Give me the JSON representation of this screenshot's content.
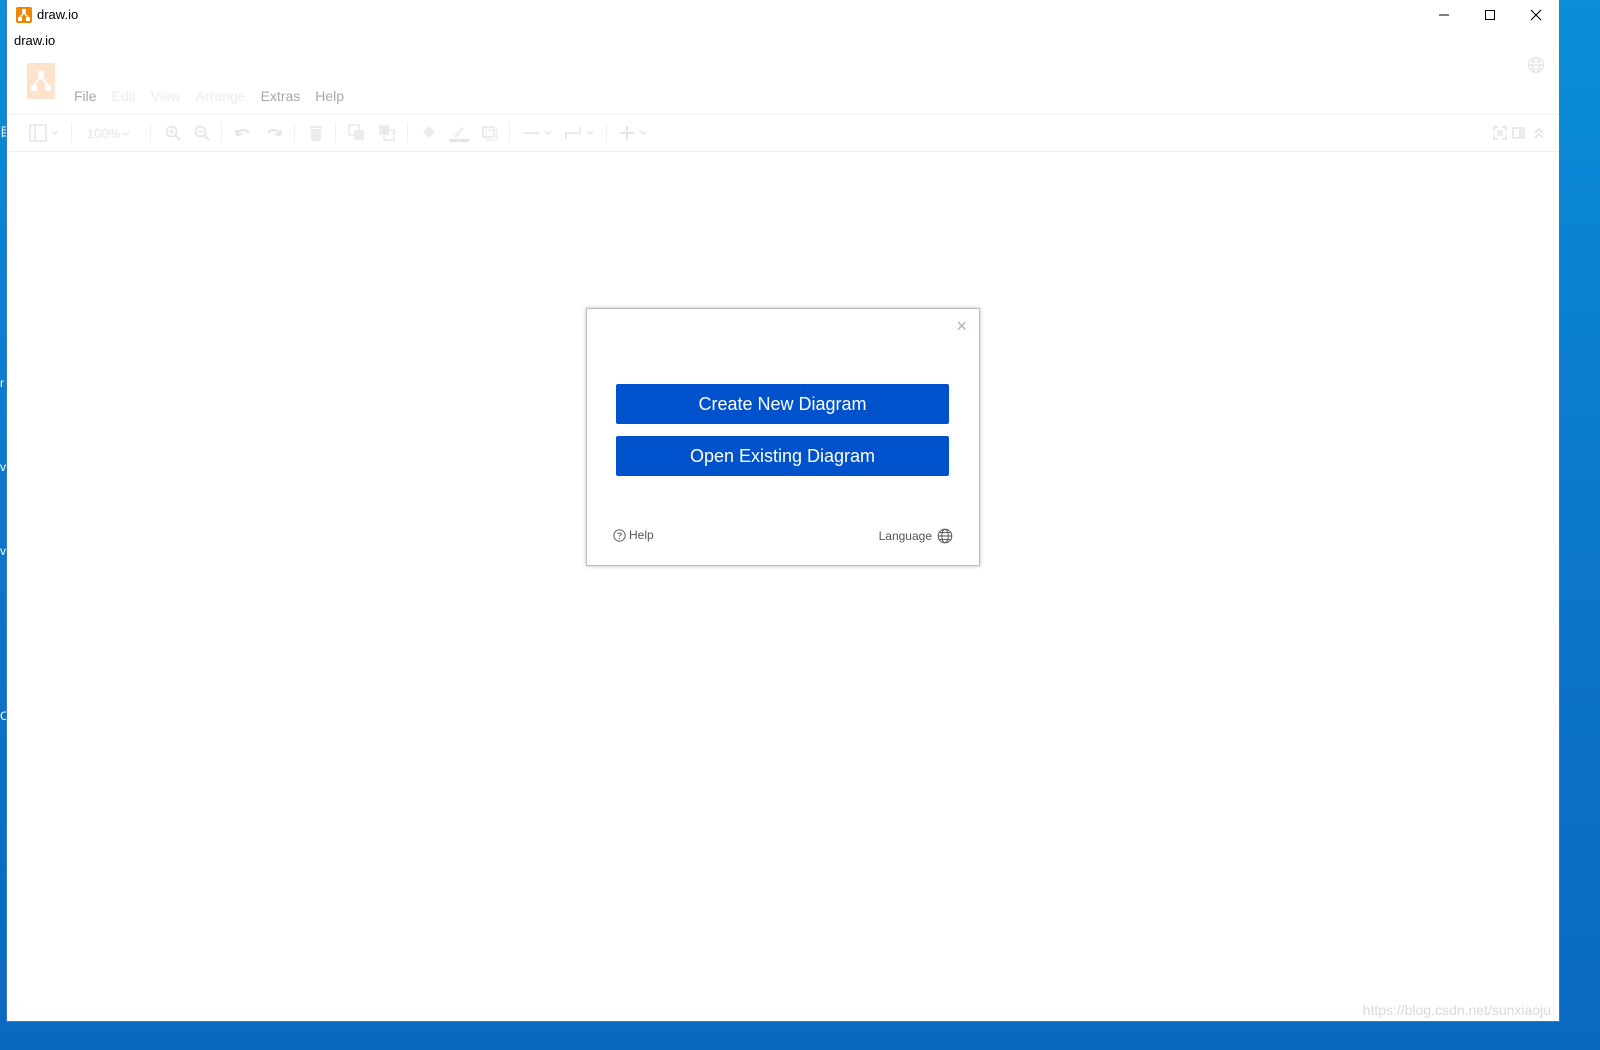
{
  "window": {
    "title": "draw.io",
    "app_label": "draw.io"
  },
  "menu": {
    "items": [
      {
        "label": "File",
        "enabled": true
      },
      {
        "label": "Edit",
        "enabled": false
      },
      {
        "label": "View",
        "enabled": false
      },
      {
        "label": "Arrange",
        "enabled": false
      },
      {
        "label": "Extras",
        "enabled": true
      },
      {
        "label": "Help",
        "enabled": true
      }
    ]
  },
  "toolbar": {
    "zoom": "100%"
  },
  "dialog": {
    "close_glyph": "×",
    "create_label": "Create New Diagram",
    "open_label": "Open Existing Diagram",
    "help_label": "Help",
    "language_label": "Language"
  },
  "desktop_fragments": [
    "目",
    "r",
    "v",
    "v",
    "C"
  ],
  "watermark": "https://blog.csdn.net/sunxiaoju",
  "colors": {
    "primary_button": "#0052cc",
    "brand_orange": "#f08705",
    "desktop_blue": "#0a8fd8"
  }
}
